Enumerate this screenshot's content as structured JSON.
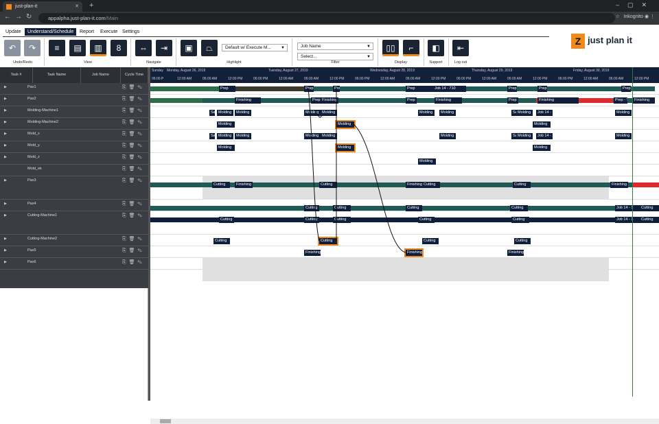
{
  "browser": {
    "tab_title": "just-plan-it",
    "url_host": "appalpha.just-plan-it.com",
    "url_path": "/Main",
    "profile": "Inkognito"
  },
  "menu": [
    "Update",
    "Understand/Schedule",
    "Report",
    "Execute",
    "Settings"
  ],
  "ribbon": {
    "groups": [
      "Undo/Redo",
      "View",
      "Navigate",
      "Highlight",
      "Filter",
      "Display",
      "Support",
      "Log out"
    ],
    "highlight_value": "Default w/ Execute M...",
    "filter_field": "Job Name",
    "filter_value": "Select..."
  },
  "logo": "just plan it",
  "columns": [
    "Task #",
    "Task Name",
    "Job Name",
    "Cycle Time"
  ],
  "rows": [
    "Pax1",
    "Pax2",
    "Molding-Machine1",
    "Molding-Machine2",
    "Mold_x",
    "Mold_y",
    "Mold_z",
    "Mold_ek",
    "Pax3",
    "Pax4",
    "Cutting-Machine1",
    "Cutting-Machine2",
    "Pax5",
    "Pax6"
  ],
  "days": [
    "Sunday",
    "Monday, August 26, 2019",
    "Tuesday, August 27, 2019",
    "Wednesday, August 28, 2019",
    "Thursday, August 29, 2019",
    "Friday, August 30, 2019"
  ],
  "hours": [
    "06:00 P",
    "12:00 AM",
    "06:00 AM",
    "12:00 PM",
    "06:00 PM",
    "12:00 AM",
    "06:00 AM",
    "12:00 PM",
    "06:00 PM",
    "12:00 AM",
    "06:00 AM",
    "12:00 PM",
    "06:00 PM",
    "12:00 AM",
    "06:00 AM",
    "12:00 PM",
    "06:00 PM",
    "12:00 AM",
    "06:00 AM",
    "12:00 PM",
    "06:00"
  ],
  "tasks": {
    "prep": "Prep",
    "finishing": "Finishing",
    "molding": "Molding",
    "cutting": "Cutting",
    "job14_710": "Job 14 - 710",
    "job14": "Job 14 - 7",
    "job14_1": "Job 14 - 1",
    "job14_140": "Job 14 - 140",
    "prep_t": "Prep - T",
    "sa": "Sa"
  },
  "colors": {
    "dark": "#0f1e3a",
    "accent": "#f08a1c",
    "green_bar": "#2b6e4a",
    "teal_bar": "#1f5a55",
    "red": "#e02a2a"
  }
}
